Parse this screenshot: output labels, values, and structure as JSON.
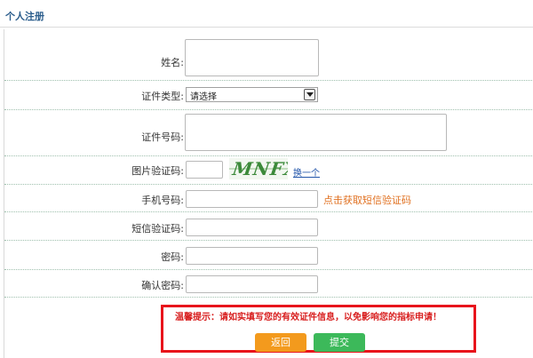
{
  "header": {
    "title": "个人注册"
  },
  "form": {
    "name_label": "姓名:",
    "id_type_label": "证件类型:",
    "id_type_selected": "请选择",
    "id_number_label": "证件号码:",
    "captcha_label": "图片验证码:",
    "captcha_text": "MNFX",
    "captcha_refresh": "换一个",
    "phone_label": "手机号码:",
    "sms_link": "点击获取短信验证码",
    "sms_code_label": "短信验证码:",
    "password_label": "密码:",
    "confirm_password_label": "确认密码:"
  },
  "notice": {
    "text": "温馨提示：请如实填写您的有效证件信息，以免影响您的指标申请！"
  },
  "buttons": {
    "back": "返回",
    "submit": "提交"
  },
  "colors": {
    "header_title": "#2b5d8c",
    "notice_border": "#e8141b",
    "notice_text": "#d81e1e",
    "back_button": "#f39a1d",
    "submit_button": "#3cb95a",
    "sms_link": "#e07020"
  }
}
